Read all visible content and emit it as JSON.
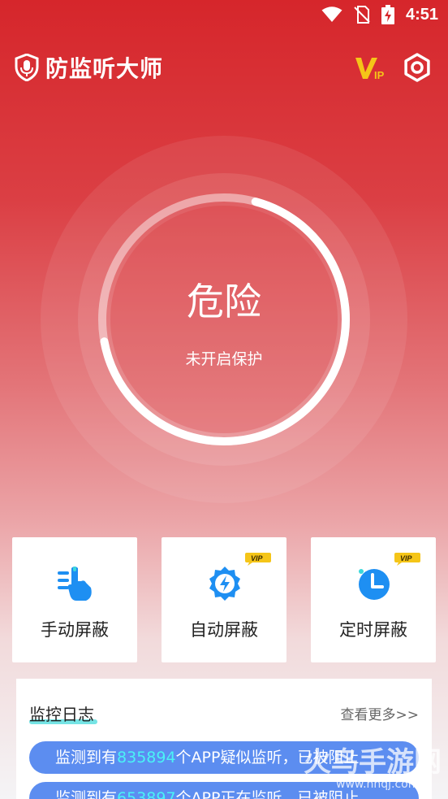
{
  "status_bar": {
    "time": "4:51"
  },
  "header": {
    "title": "防监听大师",
    "vip_label": "VIP"
  },
  "dial": {
    "status": "危险",
    "subtitle": "未开启保护"
  },
  "cards": [
    {
      "label": "手动屏蔽",
      "icon": "hand-tap-icon",
      "vip": false
    },
    {
      "label": "自动屏蔽",
      "icon": "auto-shield-icon",
      "vip": true
    },
    {
      "label": "定时屏蔽",
      "icon": "clock-icon",
      "vip": true
    }
  ],
  "vip_badge": "VIP",
  "log": {
    "title": "监控日志",
    "more": "查看更多>>",
    "items": [
      {
        "prefix": "监测到有",
        "number": "835894",
        "suffix": "个APP疑似监听，已被阻止"
      },
      {
        "prefix": "监测到有",
        "number": "653897",
        "suffix": "个APP正在监听，已被阻止"
      }
    ]
  },
  "watermark": {
    "text": "火鸟手游网",
    "url": "www.hnqj.com"
  },
  "colors": {
    "danger_red": "#d6262b",
    "accent_blue": "#1e8ff2",
    "log_pill": "#5c8df0",
    "highlight_cyan": "#4af3f6",
    "vip_yellow": "#f5c518"
  }
}
